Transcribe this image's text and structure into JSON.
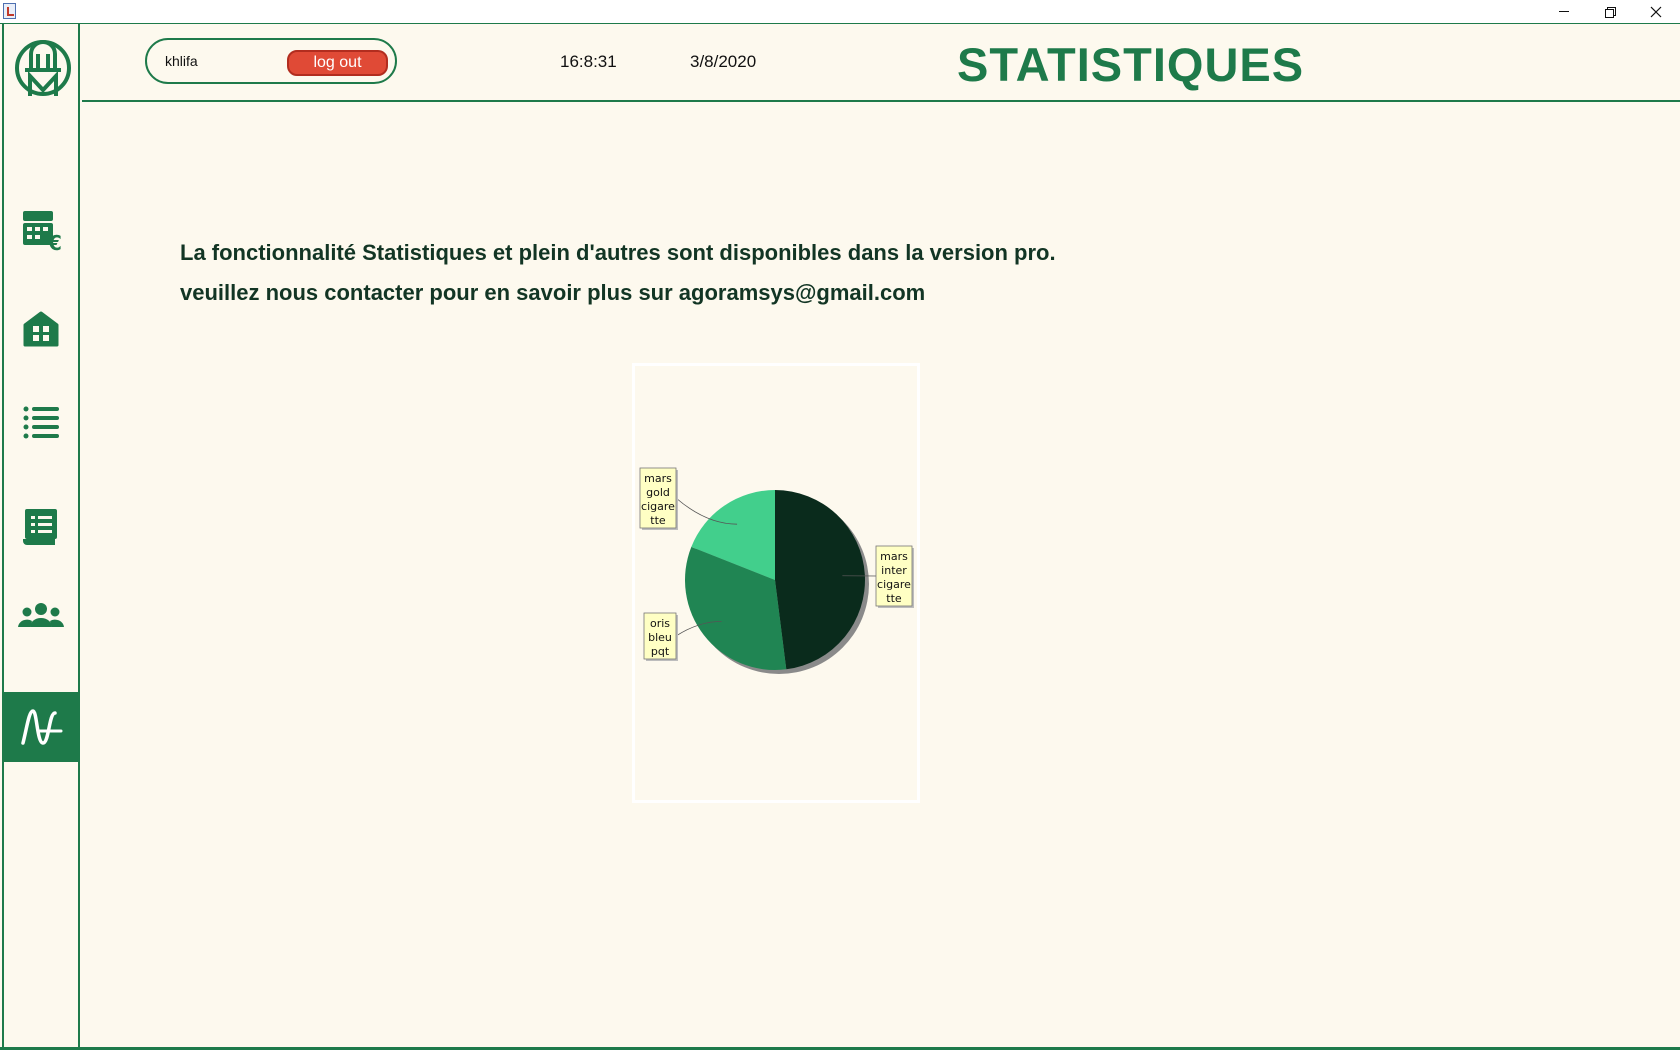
{
  "window": {
    "minimize_icon": "minimize-icon",
    "maximize_icon": "restore-icon",
    "close_icon": "close-icon"
  },
  "sidebar": {
    "items": [
      {
        "name": "sales-register-icon",
        "active": false
      },
      {
        "name": "store-icon",
        "active": false
      },
      {
        "name": "list-icon",
        "active": false
      },
      {
        "name": "invoice-icon",
        "active": false
      },
      {
        "name": "users-group-icon",
        "active": false
      },
      {
        "name": "statistics-icon",
        "active": true
      }
    ]
  },
  "header": {
    "username": "khlifa",
    "logout_label": "log out",
    "time": "16:8:31",
    "date": "3/8/2020",
    "title": "STATISTIQUES"
  },
  "message": {
    "line1": "La fonctionnalité Statistiques et plein d'autres sont disponibles dans la version pro.",
    "line2": "veuillez nous contacter pour en savoir plus sur agoramsys@gmail.com"
  },
  "colors": {
    "accent": "#1e7a4a",
    "background": "#fdf9ee",
    "logout": "#e04a36"
  },
  "chart_data": {
    "type": "pie",
    "title": "",
    "slices": [
      {
        "label": [
          "mars",
          "inter",
          "cigare",
          "tte"
        ],
        "value": 48,
        "color": "#0a2b1c"
      },
      {
        "label": [
          "oris",
          "bleu",
          "pqt"
        ],
        "value": 33,
        "color": "#208553"
      },
      {
        "label": [
          "mars",
          "gold",
          "cigare",
          "tte"
        ],
        "value": 19,
        "color": "#42cf8c"
      }
    ]
  }
}
